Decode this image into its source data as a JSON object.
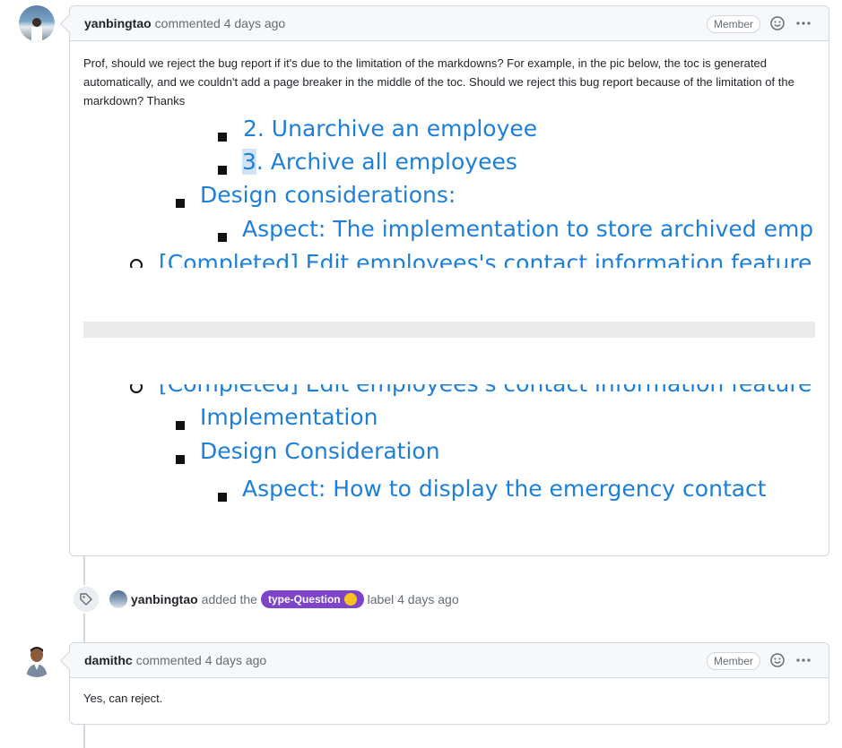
{
  "comment1": {
    "author": "yanbingtao",
    "action": "commented 4 days ago",
    "badge": "Member",
    "body": "Prof, should we reject the bug report if it's due to the limitation of the markdowns? For example, in the pic below, the toc is generated automatically, and we couldn't add a page breaker in the middle of the toc. Should we reject this bug report because of the limitation of the markdown? Thanks",
    "screenshot_items": [
      "2. Unarchive an employee",
      "3",
      ". Archive all employees",
      "Design considerations:",
      "Aspect: The implementation to store archived employees",
      "[Completed] Edit employees's contact information feature",
      "[Completed] Edit employees's contact information feature",
      "Implementation",
      "Design Consideration",
      "Aspect: How to display the emergency contact"
    ]
  },
  "event": {
    "author": "yanbingtao",
    "prefix": "added the",
    "label": "type-Question",
    "label_color": "#7d44c9",
    "suffix": "label 4 days ago"
  },
  "comment2": {
    "author": "damithc",
    "action": "commented 4 days ago",
    "badge": "Member",
    "body": "Yes, can reject."
  }
}
